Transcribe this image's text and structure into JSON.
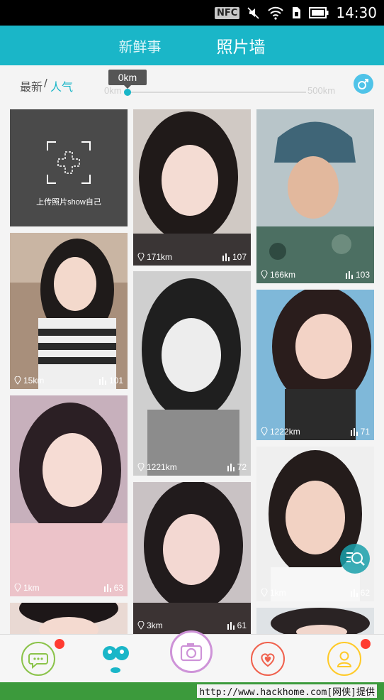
{
  "status_bar": {
    "nfc": "NFC",
    "time": "14:30"
  },
  "header": {
    "tab_news": "新鲜事",
    "tab_wall": "照片墙"
  },
  "filter": {
    "sort_newest": "最新",
    "sort_separator": "/",
    "sort_popular": "人气",
    "slider_value": "0km",
    "slider_min": "0km",
    "slider_max": "500km",
    "gender_icon": "male-symbol-icon"
  },
  "upload": {
    "label": "上传照片show自己",
    "icon": "camera-frame-plus-icon"
  },
  "photos": [
    {
      "distance": "15km",
      "popularity": "101"
    },
    {
      "distance": "1km",
      "popularity": "63"
    },
    {
      "distance": "3km",
      "popularity": "61"
    },
    {
      "distance": "171km",
      "popularity": "107"
    },
    {
      "distance": "1221km",
      "popularity": "72"
    },
    {
      "distance": "",
      "popularity": ""
    },
    {
      "distance": "166km",
      "popularity": "103"
    },
    {
      "distance": "1222km",
      "popularity": "71"
    },
    {
      "distance": "1km",
      "popularity": "62"
    },
    {
      "distance": "",
      "popularity": ""
    }
  ],
  "colors": {
    "accent": "#1ab6c8",
    "badge": "#ff3b30",
    "chat": "#8bc34a",
    "camera": "#ce93d8",
    "heart": "#f0614d",
    "profile": "#ffca28"
  },
  "bottom_nav": [
    {
      "icon": "chat-bubble-icon",
      "badge": true
    },
    {
      "icon": "discover-face-icon",
      "badge": false
    },
    {
      "icon": "camera-icon",
      "badge": false
    },
    {
      "icon": "heart-icon",
      "badge": false
    },
    {
      "icon": "profile-icon",
      "badge": true
    }
  ],
  "watermark": "http://www.hackhome.com[网侠]提供"
}
